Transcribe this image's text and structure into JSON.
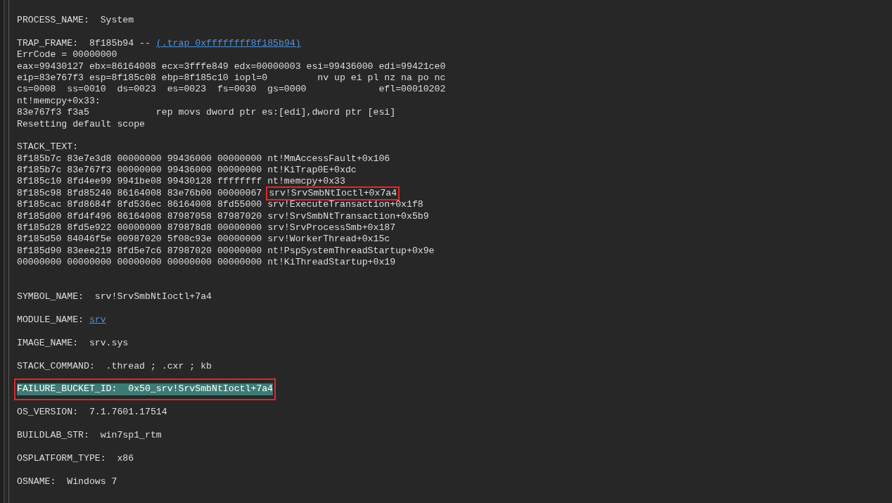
{
  "lines": [
    {
      "kind": "text",
      "text": "PROCESS_NAME:  System"
    },
    {
      "kind": "blank"
    },
    {
      "kind": "link",
      "text": "TRAP_FRAME:  8f185b94 -- ",
      "link": "(.trap 0xffffffff8f185b94)"
    },
    {
      "kind": "text",
      "text": "ErrCode = 00000000"
    },
    {
      "kind": "text",
      "text": "eax=99430127 ebx=86164008 ecx=3fffe849 edx=00000003 esi=99436000 edi=99421ce0"
    },
    {
      "kind": "text",
      "text": "eip=83e767f3 esp=8f185c08 ebp=8f185c10 iopl=0         nv up ei pl nz na po nc"
    },
    {
      "kind": "text",
      "text": "cs=0008  ss=0010  ds=0023  es=0023  fs=0030  gs=0000             efl=00010202"
    },
    {
      "kind": "text",
      "text": "nt!memcpy+0x33:"
    },
    {
      "kind": "text",
      "text": "83e767f3 f3a5            rep movs dword ptr es:[edi],dword ptr [esi]"
    },
    {
      "kind": "text",
      "text": "Resetting default scope"
    },
    {
      "kind": "blank"
    },
    {
      "kind": "text",
      "text": "STACK_TEXT:"
    },
    {
      "kind": "stack",
      "frame": "8f185b7c 83e7e3d8 00000000 99436000 00000000 ",
      "call": "nt!MmAccessFault+0x106",
      "marked": false
    },
    {
      "kind": "stack",
      "frame": "8f185b7c 83e767f3 00000000 99436000 00000000 ",
      "call": "nt!KiTrap0E+0xdc",
      "marked": false
    },
    {
      "kind": "stack",
      "frame": "8f185c10 8fd4ee99 9941be08 99430128 ffffffff ",
      "call": "nt!memcpy+0x33",
      "marked": false
    },
    {
      "kind": "stack",
      "frame": "8f185c98 8fd85240 86164008 83e76b00 00000067 ",
      "call": "srv!SrvSmbNtIoctl+0x7a4",
      "marked": true
    },
    {
      "kind": "stack",
      "frame": "8f185cac 8fd8684f 8fd536ec 86164008 8fd55000 ",
      "call": "srv!ExecuteTransaction+0x1f8",
      "marked": false
    },
    {
      "kind": "stack",
      "frame": "8f185d00 8fd4f496 86164008 87987058 87987020 ",
      "call": "srv!SrvSmbNtTransaction+0x5b9",
      "marked": false
    },
    {
      "kind": "stack",
      "frame": "8f185d28 8fd5e922 00000000 879878d8 00000000 ",
      "call": "srv!SrvProcessSmb+0x187",
      "marked": false
    },
    {
      "kind": "stack",
      "frame": "8f185d50 84046f5e 00987020 5f08c93e 00000000 ",
      "call": "srv!WorkerThread+0x15c",
      "marked": false
    },
    {
      "kind": "stack",
      "frame": "8f185d90 83eee219 8fd5e7c6 87987020 00000000 ",
      "call": "nt!PspSystemThreadStartup+0x9e",
      "marked": false
    },
    {
      "kind": "stack",
      "frame": "00000000 00000000 00000000 00000000 00000000 ",
      "call": "nt!KiThreadStartup+0x19",
      "marked": false
    },
    {
      "kind": "blank"
    },
    {
      "kind": "blank"
    },
    {
      "kind": "text",
      "text": "SYMBOL_NAME:  srv!SrvSmbNtIoctl+7a4"
    },
    {
      "kind": "blank"
    },
    {
      "kind": "link",
      "text": "MODULE_NAME: ",
      "link": "srv"
    },
    {
      "kind": "blank"
    },
    {
      "kind": "text",
      "text": "IMAGE_NAME:  srv.sys"
    },
    {
      "kind": "blank"
    },
    {
      "kind": "text",
      "text": "STACK_COMMAND:  .thread ; .cxr ; kb"
    },
    {
      "kind": "blank"
    },
    {
      "kind": "text",
      "text": "FAILURE_BUCKET_ID:  0x50_srv!SrvSmbNtIoctl+7a4",
      "selected": true,
      "marked": true
    },
    {
      "kind": "blank"
    },
    {
      "kind": "text",
      "text": "OS_VERSION:  7.1.7601.17514"
    },
    {
      "kind": "blank"
    },
    {
      "kind": "text",
      "text": "BUILDLAB_STR:  win7sp1_rtm"
    },
    {
      "kind": "blank"
    },
    {
      "kind": "text",
      "text": "OSPLATFORM_TYPE:  x86"
    },
    {
      "kind": "blank"
    },
    {
      "kind": "text",
      "text": "OSNAME:  Windows 7"
    }
  ]
}
